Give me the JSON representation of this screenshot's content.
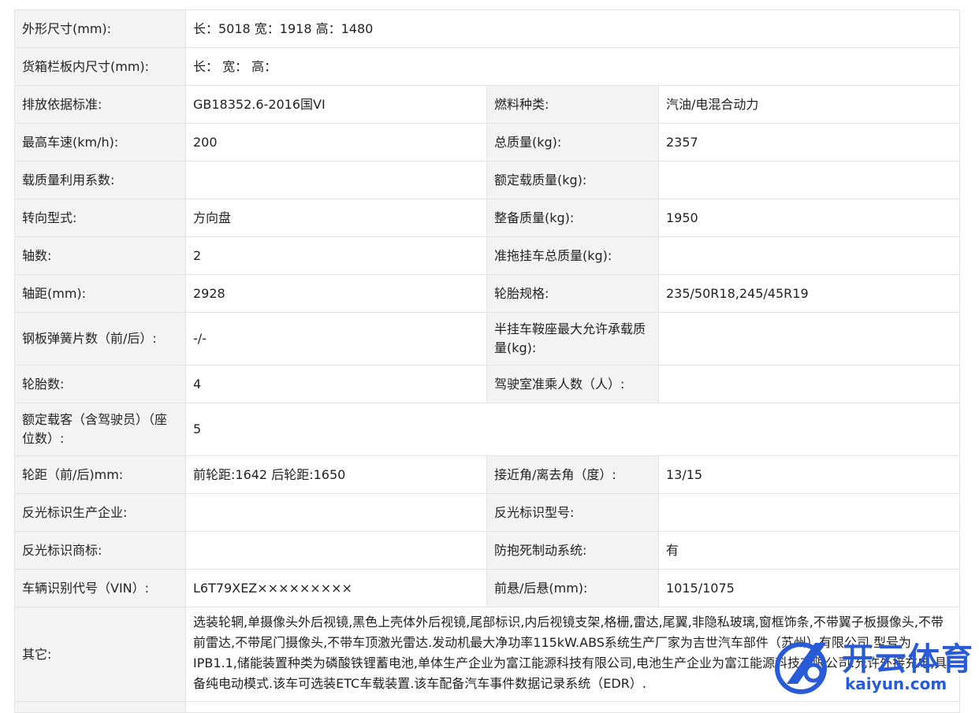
{
  "rows": [
    {
      "l1": "外形尺寸(mm):",
      "wide": "长：5018 宽：1918 高：1480"
    },
    {
      "l1": "货箱栏板内尺寸(mm):",
      "wide": "长： 宽： 高："
    },
    {
      "l1": "排放依据标准:",
      "v1": "GB18352.6-2016国VI",
      "l2": "燃料种类:",
      "v2": "汽油/电混合动力"
    },
    {
      "l1": "最高车速(km/h):",
      "v1": "200",
      "l2": "总质量(kg):",
      "v2": "2357"
    },
    {
      "l1": "载质量利用系数:",
      "v1": "",
      "l2": "额定载质量(kg):",
      "v2": ""
    },
    {
      "l1": "转向型式:",
      "v1": "方向盘",
      "l2": "整备质量(kg):",
      "v2": "1950"
    },
    {
      "l1": "轴数:",
      "v1": "2",
      "l2": "准拖挂车总质量(kg):",
      "v2": ""
    },
    {
      "l1": "轴距(mm):",
      "v1": "2928",
      "l2": "轮胎规格:",
      "v2": "235/50R18,245/45R19"
    },
    {
      "l1": "钢板弹簧片数（前/后）:",
      "v1": "-/-",
      "l2": "半挂车鞍座最大允许承载质量(kg):",
      "v2": ""
    },
    {
      "l1": "轮胎数:",
      "v1": "4",
      "l2": "驾驶室准乘人数（人）:",
      "v2": ""
    },
    {
      "l1": "额定载客（含驾驶员）（座位数）:",
      "wide": "5"
    },
    {
      "l1": "轮距（前/后)mm:",
      "v1": "前轮距:1642 后轮距:1650",
      "l2": "接近角/离去角（度）:",
      "v2": "13/15"
    },
    {
      "l1": "反光标识生产企业:",
      "v1": "",
      "l2": "反光标识型号:",
      "v2": ""
    },
    {
      "l1": "反光标识商标:",
      "v1": "",
      "l2": "防抱死制动系统:",
      "v2": "有"
    },
    {
      "l1": "车辆识别代号（VIN）:",
      "v1": "L6T79XEZ×××××××××",
      "l2": "前悬/后悬(mm):",
      "v2": "1015/1075"
    },
    {
      "l1": "其它:",
      "wide": "选装轮辋,单摄像头外后视镜,黑色上壳体外后视镜,尾部标识,内后视镜支架,格栅,雷达,尾翼,非隐私玻璃,窗框饰条,不带翼子板摄像头,不带前雷达,不带尾门摄像头,不带车顶激光雷达.发动机最大净功率115kW.ABS系统生产厂家为吉世汽车部件（苏州）有限公司,型号为IPB1.1,储能装置种类为磷酸铁锂蓄电池,单体生产企业为富江能源科技有限公司,电池生产企业为富江能源科技有限公司.允许外接充电,具备纯电动模式.该车可选装ETC车载装置.该车配备汽车事件数据记录系统（EDR）."
    }
  ],
  "watermark": {
    "title": "开云体育",
    "url": "kaiyun.com",
    "brand_color": "#2a5bd7"
  }
}
